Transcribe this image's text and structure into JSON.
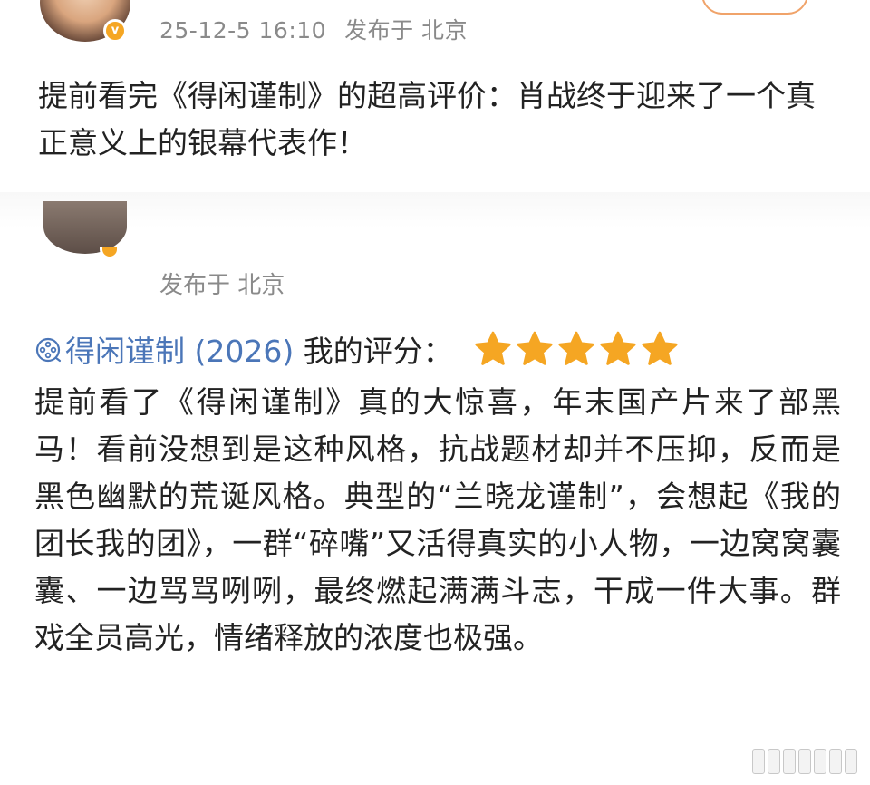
{
  "post1": {
    "timestamp": "25-12-5 16:10",
    "location": "发布于 北京",
    "text": "提前看完《得闲谨制》的超高评价：肖战终于迎来了一个真正意义上的银幕代表作！"
  },
  "post2": {
    "location": "发布于 北京",
    "movie_link": "得闲谨制 (2026)",
    "rating_label": "我的评分：",
    "rating": 5,
    "rating_max": 5,
    "text": "提前看了《得闲谨制》真的大惊喜，年末国产片来了部黑马！看前没想到是这种风格，抗战题材却并不压抑，反而是黑色幽默的荒诞风格。典型的“兰晓龙谨制”，会想起《我的团长我的团》，一群“碎嘴”又活得真实的小人物，一边窝窝囊囊、一边骂骂咧咧，最终燃起满满斗志，干成一件大事。群戏全员高光，情绪释放的浓度也极强。"
  },
  "colors": {
    "link": "#4b76b8",
    "star": "#f5a623",
    "meta_text": "#8a8a8a",
    "verified_badge": "#f5a623"
  },
  "icons": {
    "film": "film-reel-icon",
    "star": "star-icon",
    "verified": "verified-badge-icon"
  }
}
